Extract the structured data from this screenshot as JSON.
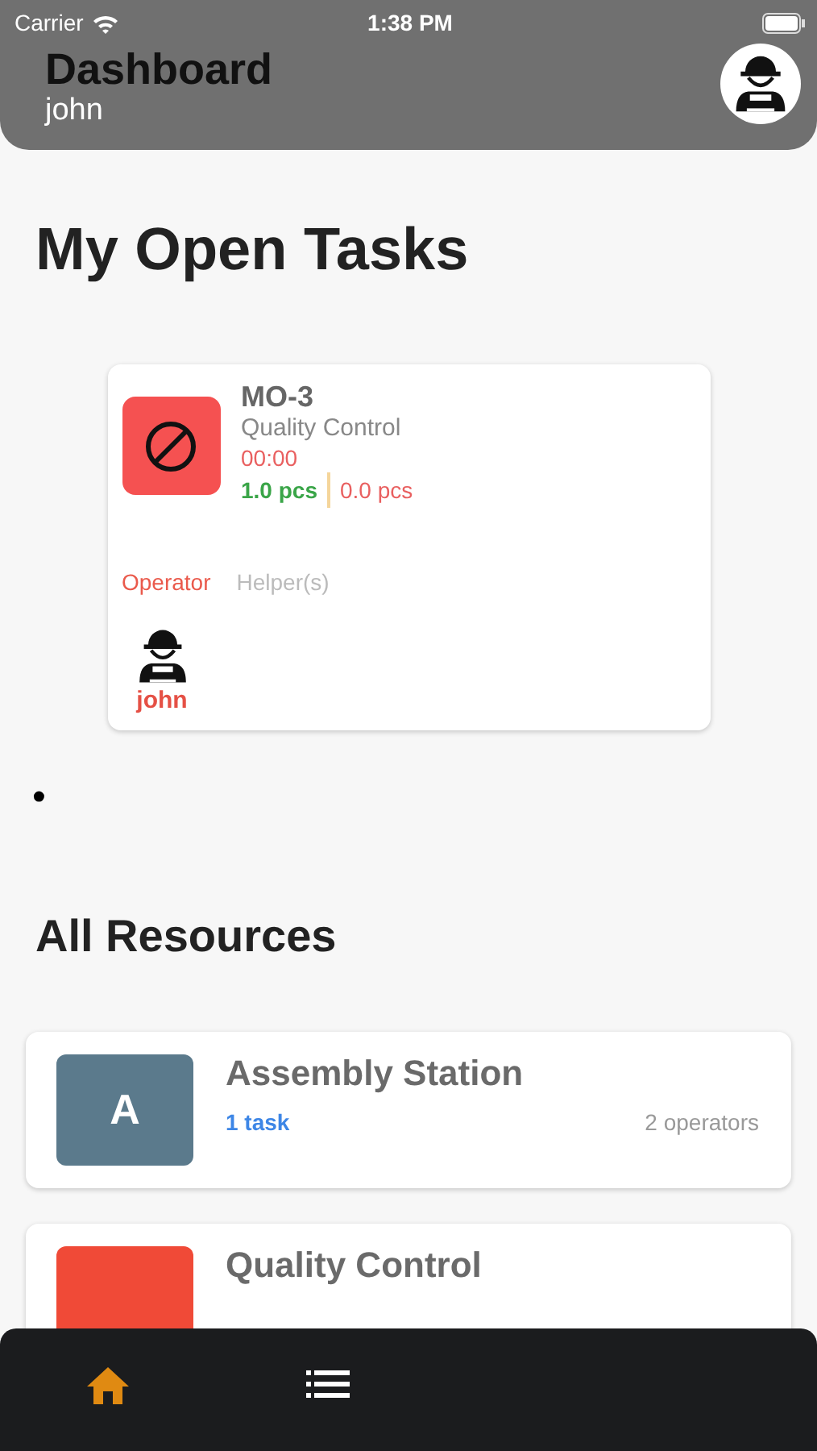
{
  "status_bar": {
    "carrier": "Carrier",
    "time": "1:38 PM"
  },
  "header": {
    "title": "Dashboard",
    "user": "john"
  },
  "open_tasks": {
    "heading": "My Open Tasks",
    "tasks": [
      {
        "code": "MO-3",
        "resource": "Quality Control",
        "timer": "00:00",
        "done_qty": "1.0 pcs",
        "scrap_qty": "0.0 pcs",
        "tabs": [
          {
            "label": "Operator",
            "selected": true
          },
          {
            "label": "Helper(s)",
            "selected": false
          }
        ],
        "people": [
          {
            "name": "john"
          }
        ]
      }
    ]
  },
  "bullet": "•",
  "resources": {
    "heading": "All Resources",
    "items": [
      {
        "letter": "A",
        "color": "#5b7a8c",
        "name": "Assembly Station",
        "tasks": "1 task",
        "operators": "2 operators"
      },
      {
        "color": "#f04a37",
        "name": "Quality Control"
      }
    ]
  },
  "bottom_nav": [
    {
      "kind": "home",
      "selected": true
    },
    {
      "kind": "list",
      "selected": false
    }
  ]
}
